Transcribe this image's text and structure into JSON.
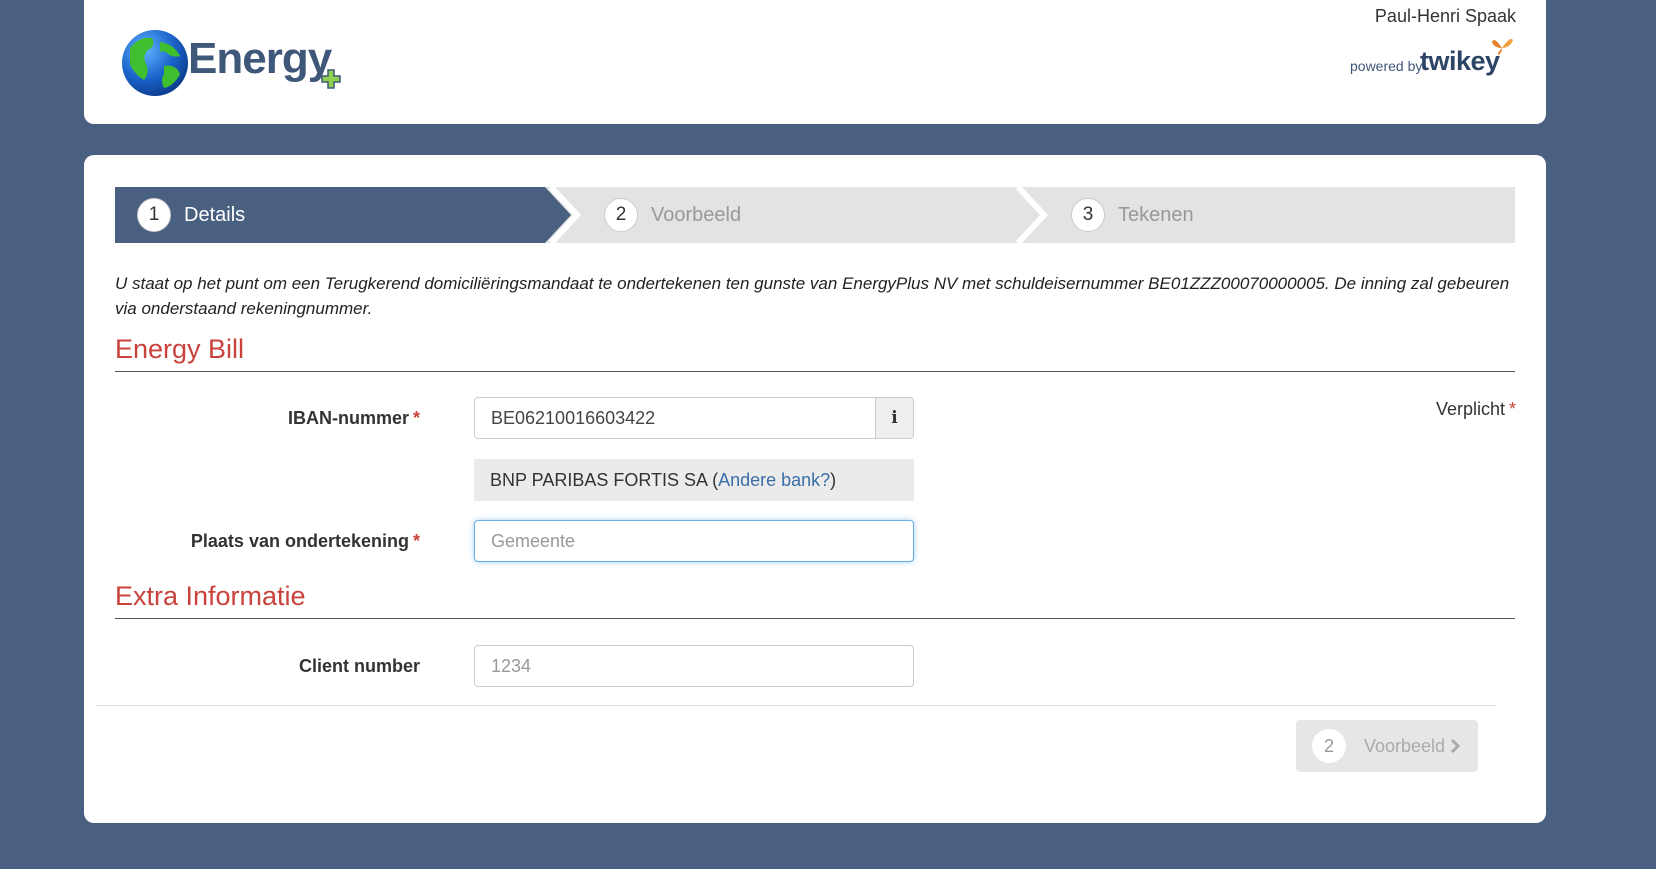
{
  "header": {
    "logo_text": "Energy",
    "user_name": "Paul-Henri Spaak",
    "powered_by": "powered by",
    "brand": "twikey"
  },
  "stepper": {
    "steps": [
      {
        "number": "1",
        "label": "Details",
        "active": true
      },
      {
        "number": "2",
        "label": "Voorbeeld",
        "active": false
      },
      {
        "number": "3",
        "label": "Tekenen",
        "active": false
      }
    ]
  },
  "intro_text": "U staat op het punt om een Terugkerend domiciliëringsmandaat te ondertekenen ten gunste van EnergyPlus NV met schuldeisernummer BE01ZZZ00070000005. De inning zal gebeuren via onderstaand rekeningnummer.",
  "sections": {
    "energy_bill": {
      "title": "Energy Bill",
      "required_note": "Verplicht",
      "iban": {
        "label": "IBAN-nummer",
        "value": "BE06210016603422",
        "info_icon": "i"
      },
      "bank": {
        "name": "BNP PARIBAS FORTIS SA (",
        "link": "Andere bank?",
        "suffix": ")"
      },
      "place": {
        "label": "Plaats van ondertekening",
        "placeholder": "Gemeente"
      }
    },
    "extra_info": {
      "title": "Extra Informatie",
      "client_number": {
        "label": "Client number",
        "placeholder": "1234"
      }
    }
  },
  "footer": {
    "next_number": "2",
    "next_label": "Voorbeeld"
  },
  "colors": {
    "background": "#4a6080",
    "accent_red": "#c9423b",
    "step_active": "#4a6080",
    "link_blue": "#3a6ea8"
  },
  "required_marker": "*"
}
